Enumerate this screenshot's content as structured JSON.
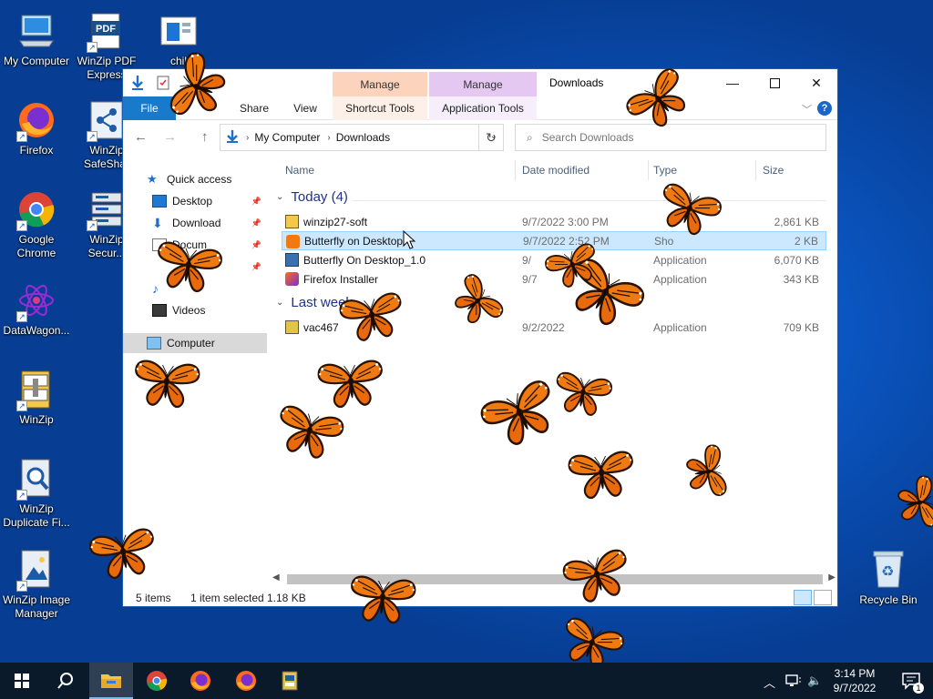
{
  "desktop": {
    "icons": [
      {
        "label": "My Computer"
      },
      {
        "label": "WinZip PDF Express"
      },
      {
        "label": "chil"
      },
      {
        "label": "Firefox"
      },
      {
        "label": "WinZip SafeShar"
      },
      {
        "label": "Google Chrome"
      },
      {
        "label": "WinZip Secur..."
      },
      {
        "label": "DataWagon..."
      },
      {
        "label": "WinZip"
      },
      {
        "label": "WinZip Duplicate Fi..."
      },
      {
        "label": "WinZip Image Manager"
      },
      {
        "label": "Recycle Bin"
      }
    ]
  },
  "window": {
    "title": "Downloads",
    "context_tabs": {
      "manage1": "Manage",
      "manage2": "Manage"
    },
    "ribbon_tabs": {
      "file": "File",
      "share": "Share",
      "view": "View",
      "shortcut_tools": "Shortcut Tools",
      "application_tools": "Application Tools"
    },
    "address": {
      "root": "My Computer",
      "current": "Downloads"
    },
    "search_placeholder": "Search Downloads",
    "nav": {
      "quick_access": "Quick access",
      "desktop": "Desktop",
      "downloads": "Download",
      "documents": "Docum",
      "music": "",
      "videos": "Videos",
      "computer": "Computer"
    },
    "columns": {
      "name": "Name",
      "date": "Date modified",
      "type": "Type",
      "size": "Size"
    },
    "groups": {
      "today": "Today (4)",
      "last_week": "Last week"
    },
    "files": [
      {
        "name": "winzip27-soft",
        "date": "9/7/2022 3:00 PM",
        "type": "",
        "size": "2,861 KB"
      },
      {
        "name": "Butterfly on Desktop",
        "date": "9/7/2022 2:52 PM",
        "type": "Sho",
        "size": "2 KB"
      },
      {
        "name": "Butterfly On Desktop_1.0",
        "date": "9/",
        "type": "Application",
        "size": "6,070 KB"
      },
      {
        "name": "Firefox Installer",
        "date": "9/7",
        "type": "Application",
        "size": "343 KB"
      },
      {
        "name": "vac467",
        "date": "9/2/2022",
        "type": "Application",
        "size": "709 KB"
      }
    ],
    "status": {
      "items": "5 items",
      "selected": "1 item selected",
      "size": "1.18 KB"
    }
  },
  "taskbar": {
    "time": "3:14 PM",
    "date": "9/7/2022",
    "notification_count": "1"
  },
  "colors": {
    "desktop_blue": "#0a55c0",
    "file_tab": "#1979ca",
    "manage_shortcut": "#fcd3bc",
    "manage_app": "#e4c8f1",
    "selection": "#cce8ff",
    "butterfly": "#f07a12"
  }
}
